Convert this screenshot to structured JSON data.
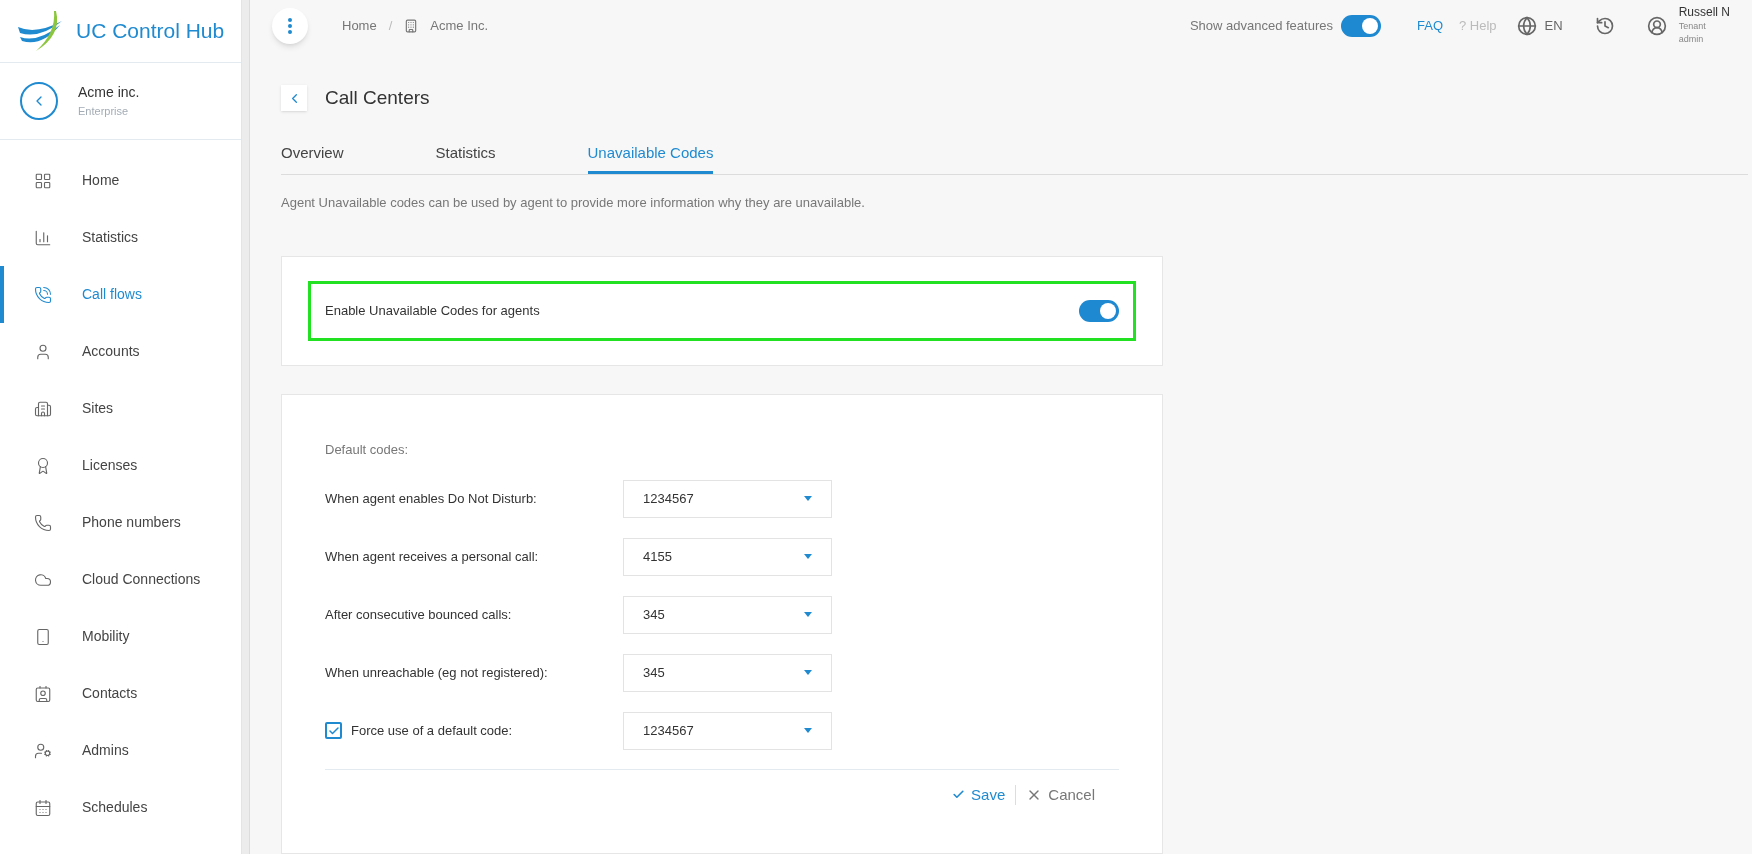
{
  "app": {
    "title": "UC Control Hub"
  },
  "organization": {
    "name": "Acme inc.",
    "type": "Enterprise"
  },
  "sidebar": {
    "items": [
      {
        "label": "Home",
        "selected": false
      },
      {
        "label": "Statistics",
        "selected": false
      },
      {
        "label": "Call flows",
        "selected": true
      },
      {
        "label": "Accounts",
        "selected": false
      },
      {
        "label": "Sites",
        "selected": false
      },
      {
        "label": "Licenses",
        "selected": false
      },
      {
        "label": "Phone numbers",
        "selected": false
      },
      {
        "label": "Cloud Connections",
        "selected": false
      },
      {
        "label": "Mobility",
        "selected": false
      },
      {
        "label": "Contacts",
        "selected": false
      },
      {
        "label": "Admins",
        "selected": false
      },
      {
        "label": "Schedules",
        "selected": false
      }
    ]
  },
  "breadcrumb": [
    "Home",
    "Acme Inc."
  ],
  "breadcrumb_separator": "/",
  "header": {
    "advanced_features": {
      "label": "Show advanced features",
      "on": true
    },
    "faq": "FAQ",
    "help": "? Help",
    "language": "EN",
    "user": {
      "name": "Russell N",
      "role": "Tenant admin"
    }
  },
  "page": {
    "title": "Call Centers",
    "tabs": [
      {
        "label": "Overview",
        "selected": false
      },
      {
        "label": "Statistics",
        "selected": false
      },
      {
        "label": "Unavailable Codes",
        "selected": true
      }
    ],
    "description": "Agent Unavailable codes can be used by agent to provide more information why they are unavailable.",
    "enable_setting": {
      "label": "Enable Unavailable Codes for agents",
      "on": true
    },
    "default_codes": {
      "heading": "Default codes:",
      "rows": [
        {
          "kind": "select",
          "label": "When agent enables Do Not Disturb:",
          "value": "1234567"
        },
        {
          "kind": "select",
          "label": "When agent receives a personal call:",
          "value": "4155"
        },
        {
          "kind": "select",
          "label": "After consecutive bounced calls:",
          "value": "345"
        },
        {
          "kind": "select",
          "label": "When unreachable (eg not registered):",
          "value": "345"
        },
        {
          "kind": "checkbox-select",
          "label": "Force use of a default code:",
          "value": "1234567",
          "checked": true
        }
      ]
    },
    "actions": {
      "save": "Save",
      "cancel": "Cancel"
    }
  }
}
